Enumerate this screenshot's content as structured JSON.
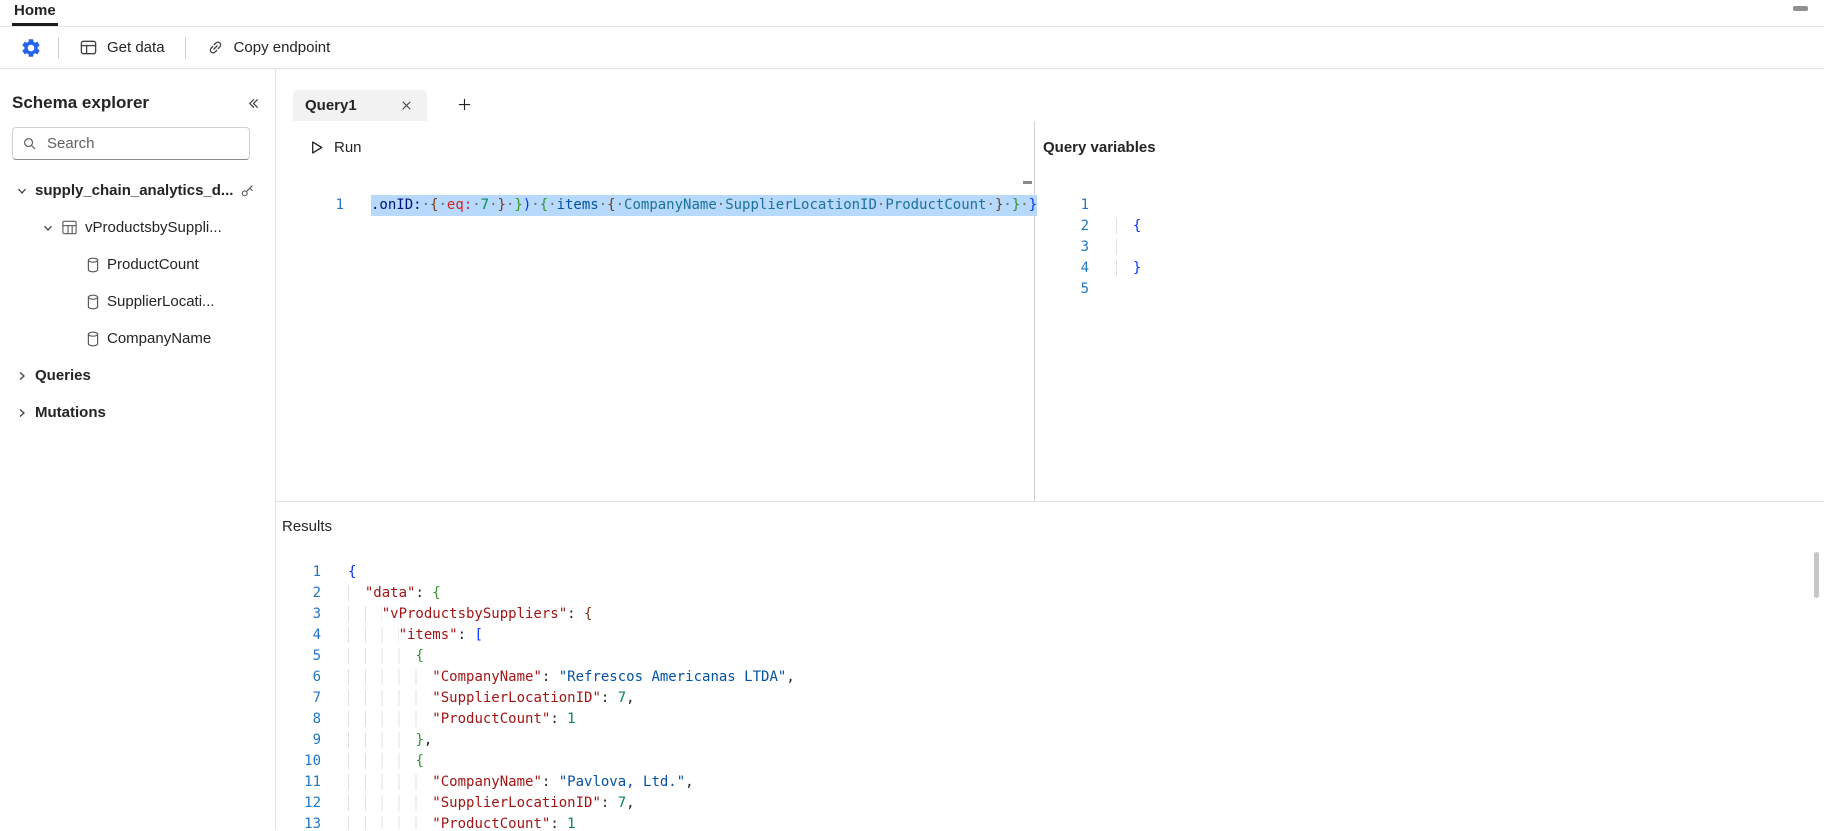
{
  "colors": {
    "accent": "#2563eb",
    "selection": "#b7d9fb",
    "linenum": "#2076c7",
    "key": "#a31515",
    "str": "#0451a5",
    "num": "#098658",
    "b1": "#0431fa",
    "b2": "#319331",
    "b3": "#7b3814",
    "field": "#1f7199",
    "attr": "#001080",
    "red": "#cf222e"
  },
  "home_tab": "Home",
  "toolbar": {
    "get_data_label": "Get data",
    "copy_endpoint_label": "Copy endpoint"
  },
  "sidebar": {
    "title": "Schema explorer",
    "search_placeholder": "Search",
    "tree": [
      {
        "label": "supply_chain_analytics_d...",
        "level": 0,
        "chevron": "down",
        "bold": true,
        "trailing_icon": "key"
      },
      {
        "label": "vProductsbySuppli...",
        "level": 1,
        "chevron": "down",
        "icon": "table"
      },
      {
        "label": "ProductCount",
        "level": 2,
        "icon": "column"
      },
      {
        "label": "SupplierLocati...",
        "level": 2,
        "icon": "column"
      },
      {
        "label": "CompanyName",
        "level": 2,
        "icon": "column"
      },
      {
        "label": "Queries",
        "level": 0,
        "chevron": "right",
        "bold": true
      },
      {
        "label": "Mutations",
        "level": 0,
        "chevron": "right",
        "bold": true
      }
    ]
  },
  "query_tab": {
    "label": "Query1"
  },
  "run_button": {
    "label": "Run"
  },
  "query_variables": {
    "title": "Query variables"
  },
  "results": {
    "title": "Results"
  },
  "editors": {
    "query": {
      "lines": [
        {
          "n": "1",
          "sel": true,
          "tokens": [
            {
              "t": ".onID:",
              "c": "attr"
            },
            {
              "t": "·",
              "c": "ws"
            },
            {
              "t": "{",
              "c": "b3"
            },
            {
              "t": "·",
              "c": "ws"
            },
            {
              "t": "eq:",
              "c": "red"
            },
            {
              "t": "·",
              "c": "ws"
            },
            {
              "t": "7",
              "c": "num"
            },
            {
              "t": "·",
              "c": "ws"
            },
            {
              "t": "}",
              "c": "b3"
            },
            {
              "t": "·",
              "c": "ws"
            },
            {
              "t": "}",
              "c": "b2"
            },
            {
              "t": ")",
              "c": "b1"
            },
            {
              "t": "·",
              "c": "ws"
            },
            {
              "t": "{",
              "c": "b2"
            },
            {
              "t": "·",
              "c": "ws"
            },
            {
              "t": "items",
              "c": "blue"
            },
            {
              "t": "·",
              "c": "ws"
            },
            {
              "t": "{",
              "c": "b3"
            },
            {
              "t": "·",
              "c": "ws"
            },
            {
              "t": "CompanyName",
              "c": "field"
            },
            {
              "t": "·",
              "c": "ws"
            },
            {
              "t": "SupplierLocationID",
              "c": "field"
            },
            {
              "t": "·",
              "c": "ws"
            },
            {
              "t": "ProductCount",
              "c": "field"
            },
            {
              "t": "·",
              "c": "ws"
            },
            {
              "t": "}",
              "c": "b3"
            },
            {
              "t": "·",
              "c": "ws"
            },
            {
              "t": "}",
              "c": "b2"
            },
            {
              "t": "·",
              "c": "ws"
            },
            {
              "t": "}",
              "c": "b1"
            }
          ]
        }
      ]
    },
    "variables": {
      "lines": [
        {
          "n": "1",
          "tokens": []
        },
        {
          "n": "2",
          "tokens": [
            {
              "t": "  ",
              "c": "ind"
            },
            {
              "t": "{",
              "c": "b1"
            }
          ]
        },
        {
          "n": "3",
          "tokens": [
            {
              "t": "  ",
              "c": "ind"
            }
          ]
        },
        {
          "n": "4",
          "tokens": [
            {
              "t": "  ",
              "c": "ind"
            },
            {
              "t": "}",
              "c": "b1"
            }
          ]
        },
        {
          "n": "5",
          "tokens": []
        }
      ]
    },
    "results": {
      "lines": [
        {
          "n": "1",
          "tokens": [
            {
              "t": "{",
              "c": "b1"
            }
          ]
        },
        {
          "n": "2",
          "tokens": [
            {
              "t": "  ",
              "c": "ind"
            },
            {
              "t": "\"data\"",
              "c": "key"
            },
            {
              "t": ": ",
              "c": "pun"
            },
            {
              "t": "{",
              "c": "b2"
            }
          ]
        },
        {
          "n": "3",
          "tokens": [
            {
              "t": "    ",
              "c": "ind"
            },
            {
              "t": "\"vProductsbySuppliers\"",
              "c": "key"
            },
            {
              "t": ": ",
              "c": "pun"
            },
            {
              "t": "{",
              "c": "b3"
            }
          ]
        },
        {
          "n": "4",
          "tokens": [
            {
              "t": "      ",
              "c": "ind"
            },
            {
              "t": "\"items\"",
              "c": "key"
            },
            {
              "t": ": ",
              "c": "pun"
            },
            {
              "t": "[",
              "c": "b1"
            }
          ]
        },
        {
          "n": "5",
          "tokens": [
            {
              "t": "        ",
              "c": "ind"
            },
            {
              "t": "{",
              "c": "b2"
            }
          ]
        },
        {
          "n": "6",
          "tokens": [
            {
              "t": "          ",
              "c": "ind"
            },
            {
              "t": "\"CompanyName\"",
              "c": "key"
            },
            {
              "t": ": ",
              "c": "pun"
            },
            {
              "t": "\"Refrescos Americanas LTDA\"",
              "c": "str"
            },
            {
              "t": ",",
              "c": "pun"
            }
          ]
        },
        {
          "n": "7",
          "tokens": [
            {
              "t": "          ",
              "c": "ind"
            },
            {
              "t": "\"SupplierLocationID\"",
              "c": "key"
            },
            {
              "t": ": ",
              "c": "pun"
            },
            {
              "t": "7",
              "c": "num"
            },
            {
              "t": ",",
              "c": "pun"
            }
          ]
        },
        {
          "n": "8",
          "tokens": [
            {
              "t": "          ",
              "c": "ind"
            },
            {
              "t": "\"ProductCount\"",
              "c": "key"
            },
            {
              "t": ": ",
              "c": "pun"
            },
            {
              "t": "1",
              "c": "num"
            }
          ]
        },
        {
          "n": "9",
          "tokens": [
            {
              "t": "        ",
              "c": "ind"
            },
            {
              "t": "}",
              "c": "b2"
            },
            {
              "t": ",",
              "c": "pun"
            }
          ]
        },
        {
          "n": "10",
          "tokens": [
            {
              "t": "        ",
              "c": "ind"
            },
            {
              "t": "{",
              "c": "b2"
            }
          ]
        },
        {
          "n": "11",
          "tokens": [
            {
              "t": "          ",
              "c": "ind"
            },
            {
              "t": "\"CompanyName\"",
              "c": "key"
            },
            {
              "t": ": ",
              "c": "pun"
            },
            {
              "t": "\"Pavlova, Ltd.\"",
              "c": "str"
            },
            {
              "t": ",",
              "c": "pun"
            }
          ]
        },
        {
          "n": "12",
          "tokens": [
            {
              "t": "          ",
              "c": "ind"
            },
            {
              "t": "\"SupplierLocationID\"",
              "c": "key"
            },
            {
              "t": ": ",
              "c": "pun"
            },
            {
              "t": "7",
              "c": "num"
            },
            {
              "t": ",",
              "c": "pun"
            }
          ]
        },
        {
          "n": "13",
          "tokens": [
            {
              "t": "          ",
              "c": "ind"
            },
            {
              "t": "\"ProductCount\"",
              "c": "key"
            },
            {
              "t": ": ",
              "c": "pun"
            },
            {
              "t": "1",
              "c": "num"
            }
          ]
        }
      ]
    }
  }
}
